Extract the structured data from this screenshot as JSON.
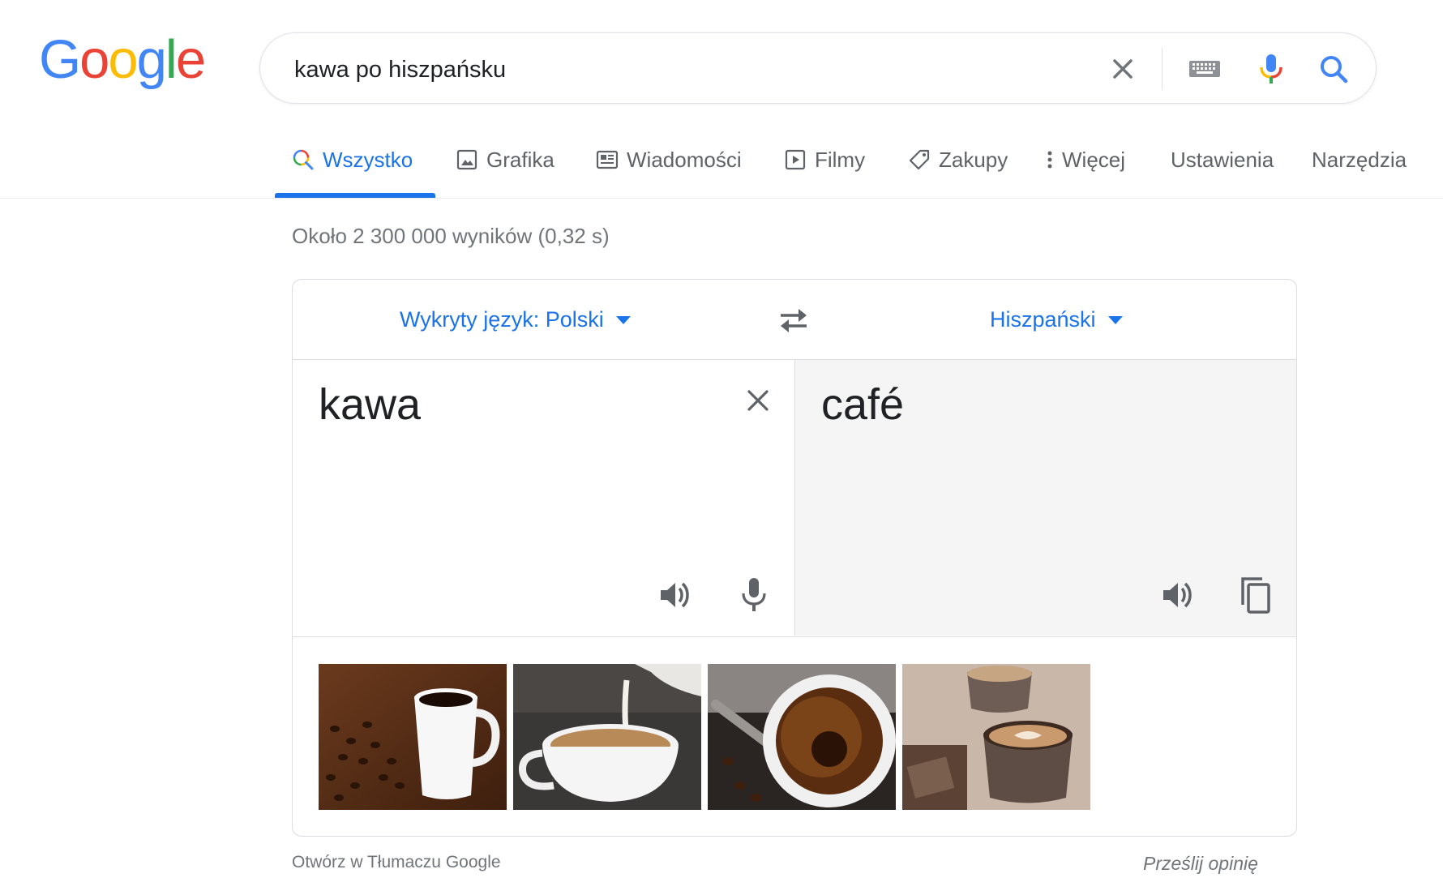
{
  "logo": {
    "letters": [
      "G",
      "o",
      "o",
      "g",
      "l",
      "e"
    ],
    "colors": [
      "#4285F4",
      "#EA4335",
      "#FBBC05",
      "#4285F4",
      "#34A853",
      "#EA4335"
    ]
  },
  "search": {
    "query": "kawa po hiszpańsku"
  },
  "icons": {
    "clear": "close-icon",
    "keyboard": "keyboard-icon",
    "mic": "mic-icon",
    "search": "search-icon"
  },
  "tabs": [
    {
      "label": "Wszystko",
      "icon": "search-icon",
      "active": true
    },
    {
      "label": "Grafika",
      "icon": "image-icon"
    },
    {
      "label": "Wiadomości",
      "icon": "news-icon"
    },
    {
      "label": "Filmy",
      "icon": "play-icon"
    },
    {
      "label": "Zakupy",
      "icon": "tag-icon"
    },
    {
      "label": "Więcej",
      "icon": "more-vert-icon"
    },
    {
      "label": "Ustawienia"
    },
    {
      "label": "Narzędzia"
    }
  ],
  "results_stats": "Około 2 300 000 wyników (0,32 s)",
  "translate": {
    "source_lang": "Wykryty język: Polski",
    "target_lang": "Hiszpański",
    "source_text": "kawa",
    "target_text": "café",
    "images": [
      "coffee-cup-with-beans",
      "milk-pouring-into-coffee",
      "espresso-top-view",
      "latte-art-cups"
    ]
  },
  "footer": {
    "open_in_translate": "Otwórz w Tłumaczu Google",
    "send_feedback": "Prześlij opinię"
  },
  "colors": {
    "accent": "#1a73e8",
    "text_secondary": "#5f6368",
    "border": "#dadce0"
  }
}
